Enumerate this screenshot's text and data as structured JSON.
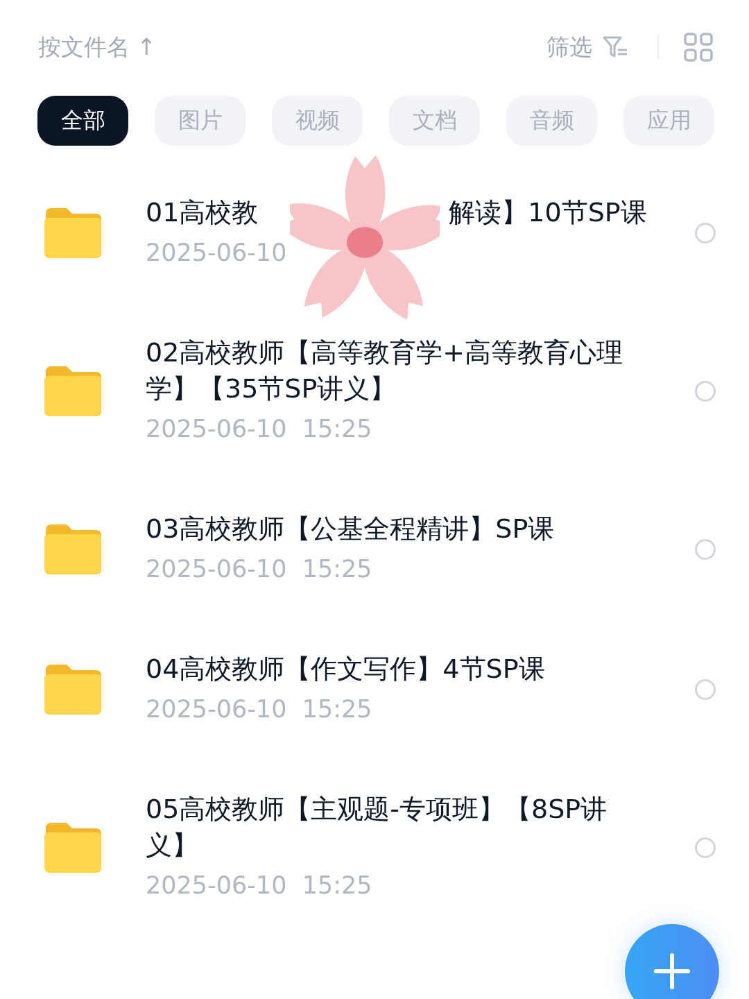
{
  "header": {
    "sort": "按文件名 ↑",
    "filter": "筛选"
  },
  "tabs": [
    {
      "label": "全部",
      "selected": true
    },
    {
      "label": "图片",
      "selected": false
    },
    {
      "label": "视频",
      "selected": false
    },
    {
      "label": "文档",
      "selected": false
    },
    {
      "label": "音频",
      "selected": false
    },
    {
      "label": "应用",
      "selected": false
    }
  ],
  "files": [
    {
      "title_parts": [
        "01高校教",
        "解读】10节SP课"
      ],
      "date": "2025-06-10",
      "selected": false
    },
    {
      "title": "02高校教师【高等教育学+高等教育心理学】【35节SP讲义】",
      "date": "2025-06-10  15:25",
      "selected": false
    },
    {
      "title": "03高校教师【公基全程精讲】SP课",
      "date": "2025-06-10  15:25",
      "selected": false
    },
    {
      "title": "04高校教师【作文写作】4节SP课",
      "date": "2025-06-10  15:25",
      "selected": false
    },
    {
      "title": "05高校教师【主观题-专项班】【8SP讲义】",
      "date": "2025-06-10  15:25",
      "selected": false
    }
  ],
  "sticker": {
    "kind": "flower"
  }
}
